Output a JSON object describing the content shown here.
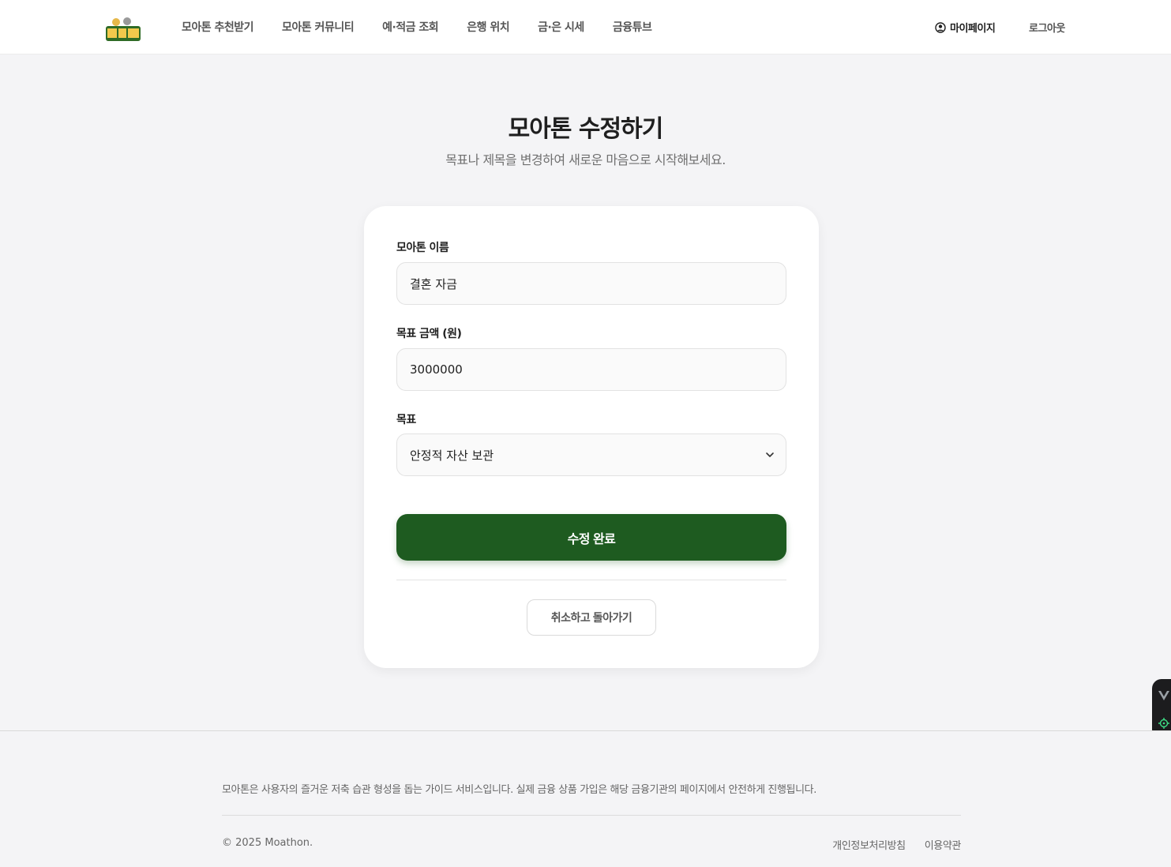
{
  "header": {
    "logo_alt": "모아톤",
    "nav": [
      "모아톤 추천받기",
      "모아톤 커뮤니티",
      "예·적금 조회",
      "은행 위치",
      "금·은 시세",
      "금융튜브"
    ],
    "mypage": "마이페이지",
    "logout": "로그아웃"
  },
  "page": {
    "title": "모아톤 수정하기",
    "subtitle": "목표나 제목을 변경하여 새로운 마음으로 시작해보세요."
  },
  "form": {
    "name_label": "모아톤 이름",
    "name_value": "결혼 자금",
    "amount_label": "목표 금액 (원)",
    "amount_value": "3000000",
    "goal_label": "목표",
    "goal_value": "안정적 자산 보관",
    "submit": "수정 완료",
    "cancel": "취소하고 돌아가기"
  },
  "footer": {
    "description": "모아톤은 사용자의 즐거운 저축 습관 형성을 돕는 가이드 서비스입니다. 실제 금융 상품 가입은 해당 금융기관의 페이지에서 안전하게 진행됩니다.",
    "copyright": "© 2025 Moathon.",
    "links": [
      "개인정보처리방침",
      "이용약관"
    ]
  },
  "colors": {
    "accent": "#1e5b20",
    "background": "#f4f4f6"
  },
  "icons": [
    "logo-icon",
    "user-circle-icon",
    "chevron-down-icon",
    "vue-devtools-icon",
    "target-icon"
  ]
}
